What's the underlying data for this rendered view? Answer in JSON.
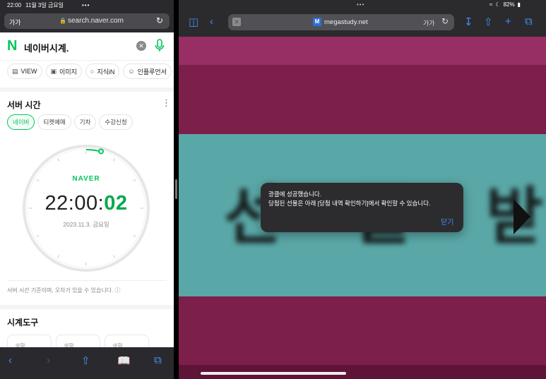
{
  "left": {
    "status": {
      "time": "22:00",
      "date": "11월 3일 금요일",
      "dots": "•••"
    },
    "address": {
      "text_size": "가가",
      "url": "search.naver.com"
    },
    "search": {
      "logo": "N",
      "query": "네이버시계."
    },
    "tabs": [
      {
        "label": "VIEW",
        "icon": "view-icon"
      },
      {
        "label": "이미지",
        "icon": "image-icon"
      },
      {
        "label": "지식iN",
        "icon": "kin-icon"
      },
      {
        "label": "인플루언서",
        "icon": "person-icon"
      }
    ],
    "server_time": {
      "title": "서버 시간",
      "subtabs": [
        "네이버",
        "티켓예매",
        "기차",
        "수강신청"
      ],
      "brand": "NAVER",
      "time_hm": "22:00:",
      "time_sec": "02",
      "date": "2023.11.3. 금요일",
      "notice": "서버 시간 기준이며, 오차가 있을 수 있습니다."
    },
    "tools": {
      "title": "시계도구",
      "cards": [
        "생활",
        "생활",
        "생활"
      ]
    }
  },
  "right": {
    "status": {
      "dots": "•••",
      "battery": "82%"
    },
    "address": {
      "url": "megastudy.net",
      "text_size": "가가"
    },
    "banner_text": "선 물 받 기",
    "alert": {
      "line1": "광클에 성공했습니다.",
      "line2": "당첨된 선물은 아래 [당첨 내역 확인하기]에서 확인할 수 있습니다.",
      "button": "닫기"
    }
  },
  "colors": {
    "naver_green": "#03c75a",
    "ios_blue": "#3f8ef5",
    "magenta": "#7c1f4b",
    "teal": "#5aa7a7"
  }
}
